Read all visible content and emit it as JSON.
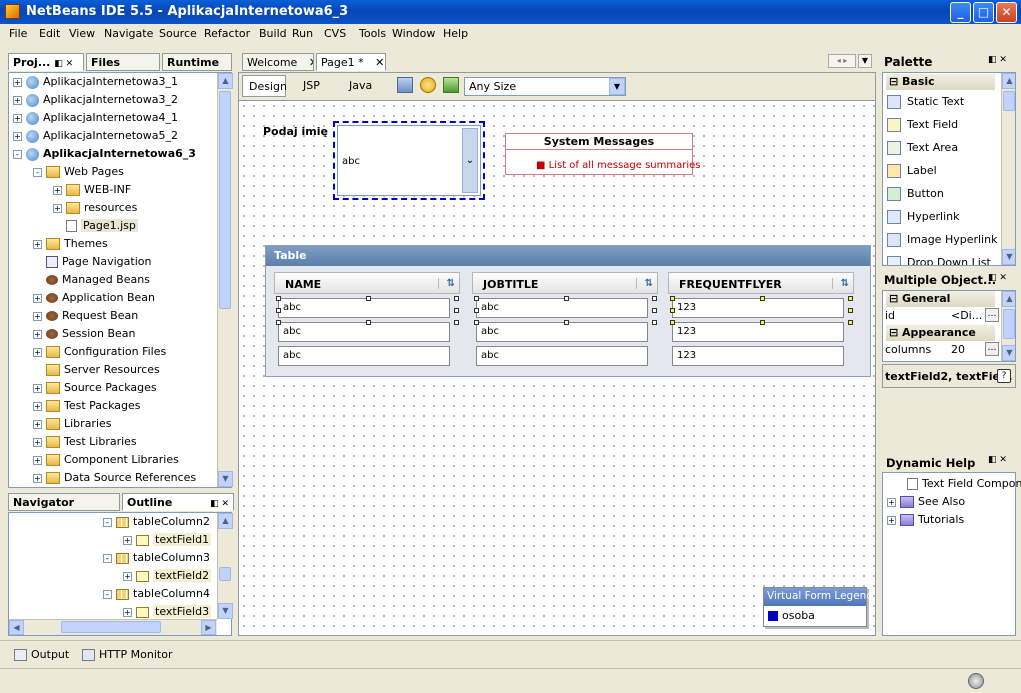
{
  "window": {
    "title": "NetBeans IDE 5.5 - AplikacjaInternetowa6_3"
  },
  "menu": [
    "File",
    "Edit",
    "View",
    "Navigate",
    "Source",
    "Refactor",
    "Build",
    "Run",
    "CVS",
    "Tools",
    "Window",
    "Help"
  ],
  "projects_panel": {
    "tabs": [
      "Proj...",
      "Files",
      "Runtime"
    ],
    "tree": [
      {
        "label": "AplikacjaInternetowa3_1",
        "level": 0,
        "icon": "project-icon",
        "exp": "+"
      },
      {
        "label": "AplikacjaInternetowa3_2",
        "level": 0,
        "icon": "project-icon",
        "exp": "+"
      },
      {
        "label": "AplikacjaInternetowa4_1",
        "level": 0,
        "icon": "project-icon",
        "exp": "+"
      },
      {
        "label": "AplikacjaInternetowa5_2",
        "level": 0,
        "icon": "project-icon",
        "exp": "+"
      },
      {
        "label": "AplikacjaInternetowa6_3",
        "level": 0,
        "icon": "project-icon",
        "exp": "-",
        "bold": true
      },
      {
        "label": "Web Pages",
        "level": 1,
        "icon": "folder-icon",
        "exp": "-"
      },
      {
        "label": "WEB-INF",
        "level": 2,
        "icon": "folder-icon",
        "exp": "+"
      },
      {
        "label": "resources",
        "level": 2,
        "icon": "folder-icon",
        "exp": "+"
      },
      {
        "label": "Page1.jsp",
        "level": 2,
        "icon": "jsp-page-icon",
        "exp": "",
        "selected": true
      },
      {
        "label": "Themes",
        "level": 1,
        "icon": "folder-icon",
        "exp": "+"
      },
      {
        "label": "Page Navigation",
        "level": 1,
        "icon": "navigation-icon",
        "exp": ""
      },
      {
        "label": "Managed Beans",
        "level": 1,
        "icon": "bean-icon",
        "exp": ""
      },
      {
        "label": "Application Bean",
        "level": 1,
        "icon": "bean-icon",
        "exp": "+"
      },
      {
        "label": "Request Bean",
        "level": 1,
        "icon": "bean-icon",
        "exp": "+"
      },
      {
        "label": "Session Bean",
        "level": 1,
        "icon": "bean-icon",
        "exp": "+"
      },
      {
        "label": "Configuration Files",
        "level": 1,
        "icon": "folder-icon",
        "exp": "+"
      },
      {
        "label": "Server Resources",
        "level": 1,
        "icon": "folder-icon",
        "exp": ""
      },
      {
        "label": "Source Packages",
        "level": 1,
        "icon": "folder-icon",
        "exp": "+"
      },
      {
        "label": "Test Packages",
        "level": 1,
        "icon": "folder-icon",
        "exp": "+"
      },
      {
        "label": "Libraries",
        "level": 1,
        "icon": "folder-icon",
        "exp": "+"
      },
      {
        "label": "Test Libraries",
        "level": 1,
        "icon": "folder-icon",
        "exp": "+"
      },
      {
        "label": "Component Libraries",
        "level": 1,
        "icon": "folder-icon",
        "exp": "+"
      },
      {
        "label": "Data Source References",
        "level": 1,
        "icon": "folder-icon",
        "exp": "+"
      }
    ]
  },
  "outline_panel": {
    "tabs": [
      "Navigator",
      "Outline"
    ],
    "tree": [
      {
        "label": "tableColumn2",
        "level": 0,
        "exp": "-"
      },
      {
        "label": "textField1",
        "level": 1,
        "exp": "+",
        "hl": true
      },
      {
        "label": "tableColumn3",
        "level": 0,
        "exp": "-"
      },
      {
        "label": "textField2",
        "level": 1,
        "exp": "+",
        "hl": true
      },
      {
        "label": "tableColumn4",
        "level": 0,
        "exp": "-"
      },
      {
        "label": "textField3",
        "level": 1,
        "exp": "+",
        "hl": true
      }
    ]
  },
  "editor": {
    "tabs": [
      "Welcome",
      "Page1 *"
    ],
    "toolbar": {
      "design": "Design",
      "jsp": "JSP",
      "java": "Java",
      "size": "Any Size"
    },
    "page": {
      "label": "Podaj imię",
      "dropdown_value": "abc",
      "messages_title": "System Messages",
      "messages_item": "List of all message summaries",
      "table_title": "Table",
      "columns": [
        "NAME",
        "JOBTITLE",
        "FREQUENTFLYER"
      ],
      "rows": [
        [
          "abc",
          "abc",
          "123"
        ],
        [
          "abc",
          "abc",
          "123"
        ],
        [
          "abc",
          "abc",
          "123"
        ]
      ],
      "legend_title": "Virtual Form Legend",
      "legend_item": "osoba"
    }
  },
  "palette": {
    "title": "Palette",
    "section": "Basic",
    "items": [
      "Static Text",
      "Text Field",
      "Text Area",
      "Label",
      "Button",
      "Hyperlink",
      "Image Hyperlink",
      "Drop Down List"
    ]
  },
  "properties": {
    "title": "Multiple Object...",
    "general": "General",
    "id_key": "id",
    "id_val": "<Di...",
    "appearance": "Appearance",
    "columns_key": "columns",
    "columns_val": "20",
    "footer": "textField2, textFie..."
  },
  "help": {
    "title": "Dynamic Help",
    "items": [
      "Text Field Compon",
      "See Also",
      "Tutorials"
    ]
  },
  "bottom": {
    "output": "Output",
    "http": "HTTP Monitor"
  },
  "colors": {
    "accent": "#0a5fd8",
    "selection": "#0032c8",
    "messages": "#c00000",
    "table_header": "#5b7fa8"
  }
}
